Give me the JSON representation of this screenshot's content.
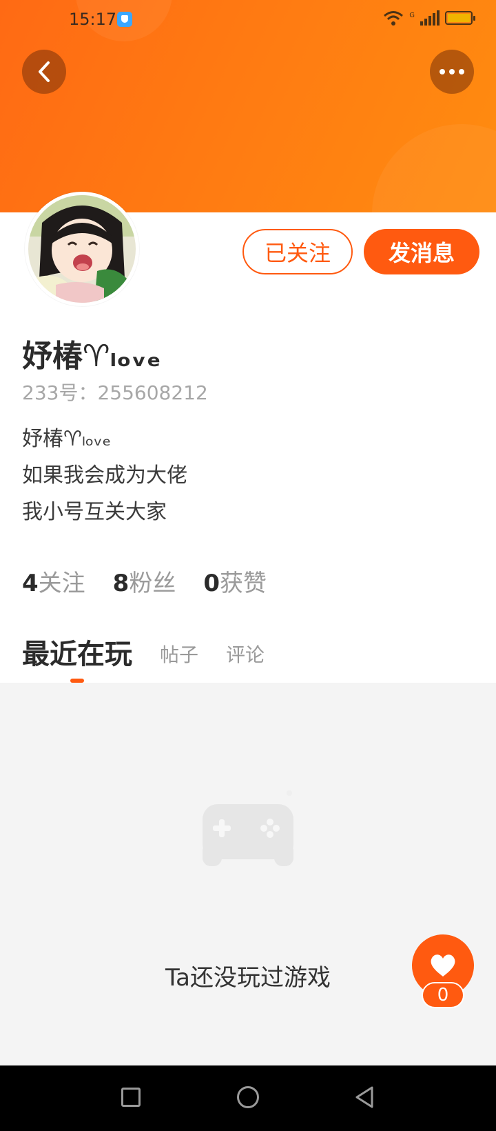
{
  "status_bar": {
    "time": "15:17",
    "network_label": "G"
  },
  "header": {
    "back_icon": "chevron-left-icon",
    "more_icon": "more-horizontal-icon"
  },
  "profile": {
    "username": "妤椿♈ₗₒᵥₑ",
    "user_id": "233号：255608212",
    "bio_lines": [
      "妤椿♈ₗₒᵥₑ",
      "如果我会成为大佬",
      "我小号互关大家"
    ],
    "follow_label": "已关注",
    "message_label": "发消息"
  },
  "stats": {
    "following": {
      "count": "4",
      "label": "关注"
    },
    "fans": {
      "count": "8",
      "label": "粉丝"
    },
    "likes": {
      "count": "0",
      "label": "获赞"
    }
  },
  "tabs": [
    {
      "label": "最近在玩",
      "active": true
    },
    {
      "label": "帖子",
      "active": false
    },
    {
      "label": "评论",
      "active": false
    }
  ],
  "empty_state": {
    "text": "Ta还没玩过游戏",
    "icon": "gamepad-icon"
  },
  "like_button": {
    "count": "0",
    "icon": "heart-icon"
  },
  "colors": {
    "accent": "#ff5a10",
    "header_start": "#ff6a14",
    "header_end": "#ff8c10"
  }
}
